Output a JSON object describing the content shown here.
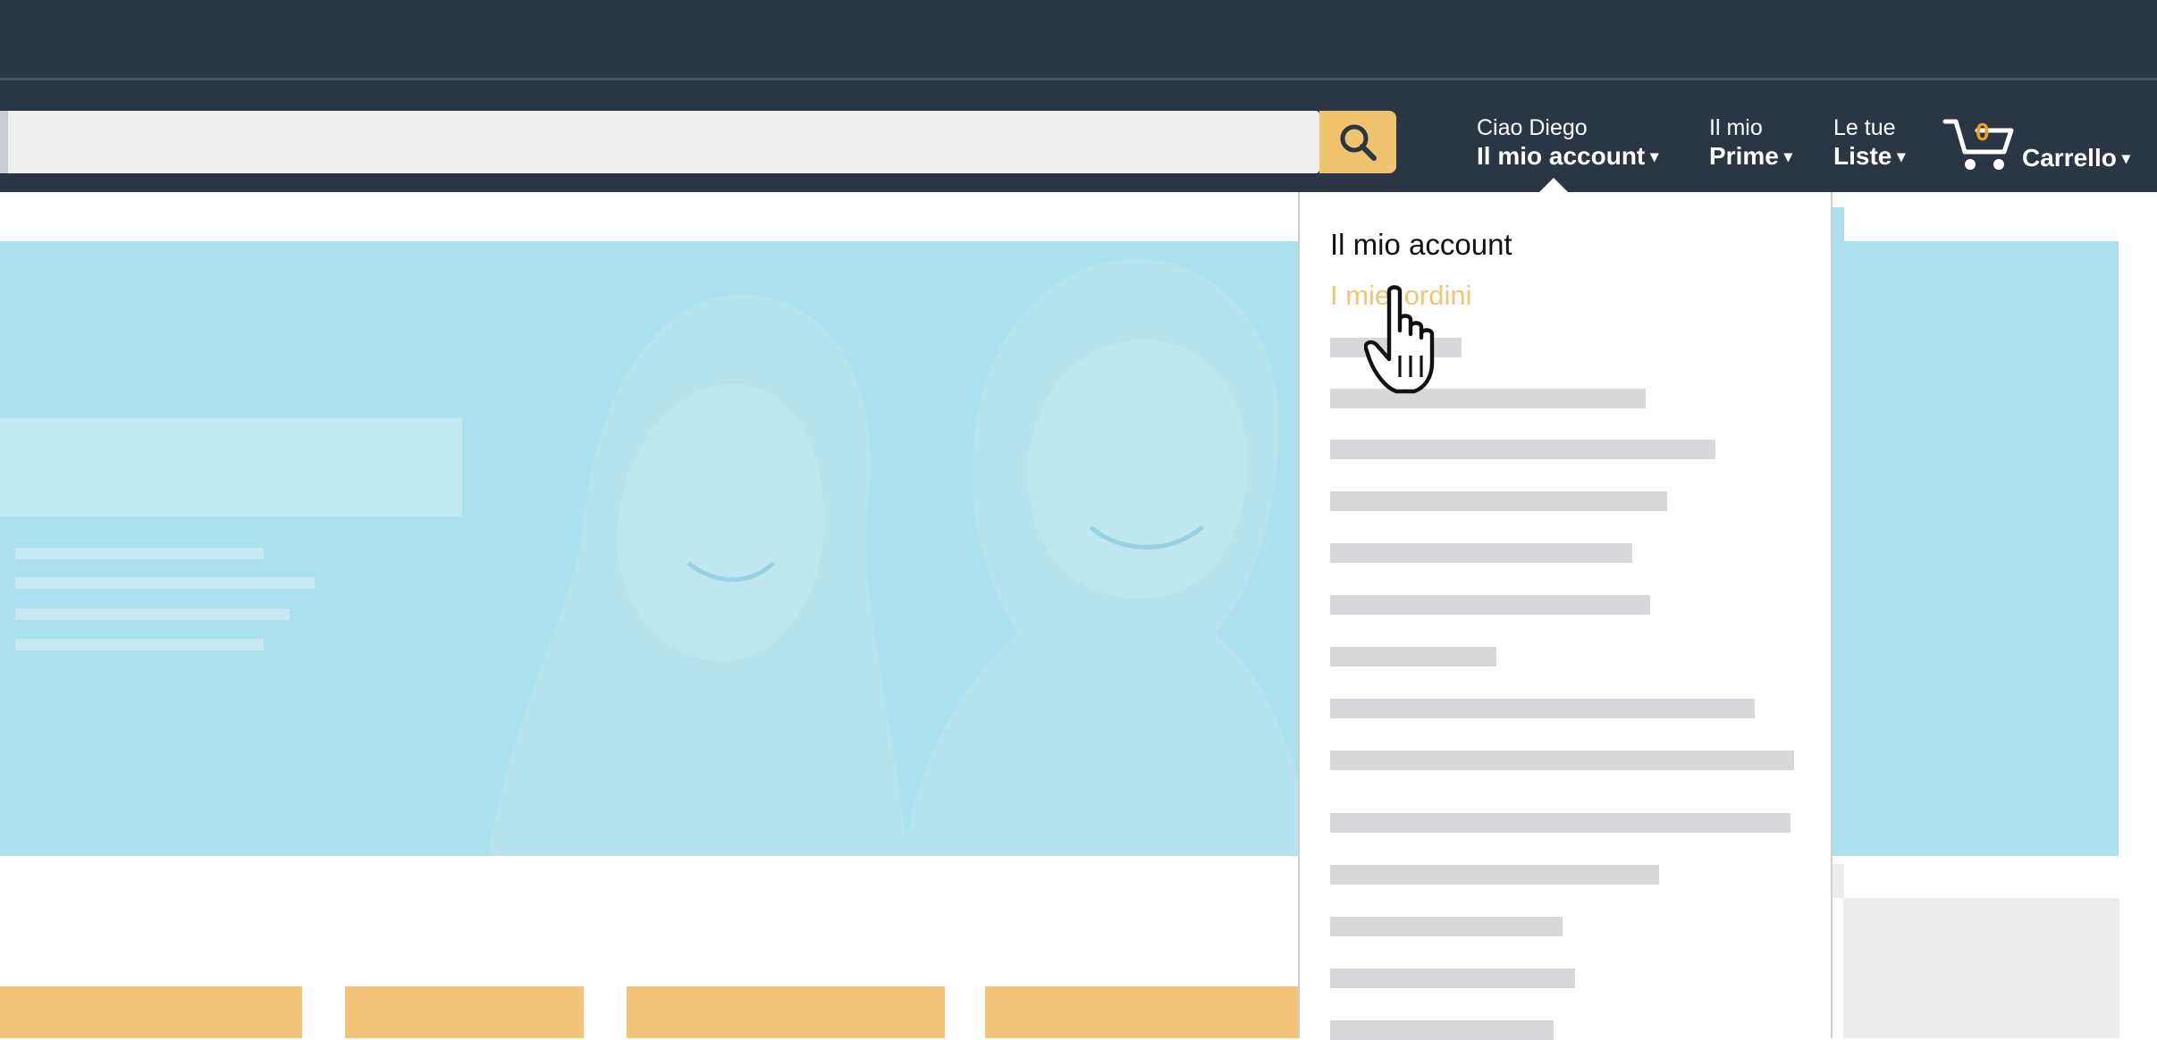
{
  "header": {
    "account": {
      "greeting": "Ciao Diego",
      "label": "Il mio account"
    },
    "prime": {
      "top": "Il mio",
      "label": "Prime"
    },
    "lists": {
      "top": "Le tue",
      "label": "Liste"
    },
    "cart": {
      "count": "0",
      "label": "Carrello"
    },
    "caret": "▾"
  },
  "search": {
    "value": "",
    "placeholder": ""
  },
  "account_menu": {
    "title": "Il mio account",
    "orders_link": "I miei ordini",
    "placeholder_items": [
      0.3,
      0.72,
      0.88,
      0.77,
      0.69,
      0.73,
      0.38,
      0.97,
      1.06,
      1.05,
      0.75,
      0.53,
      0.56,
      0.51
    ]
  },
  "colors": {
    "nav_background": "#2b3645",
    "search_button": "#f0c36f",
    "hero_background": "#abe0ee",
    "orders_link": "#f2c476",
    "cart_count": "#f0a020",
    "card_orange": "#f3c478"
  },
  "icons": {
    "search": "search-icon",
    "cart": "cart-icon",
    "pointer": "hand-pointer-icon"
  }
}
